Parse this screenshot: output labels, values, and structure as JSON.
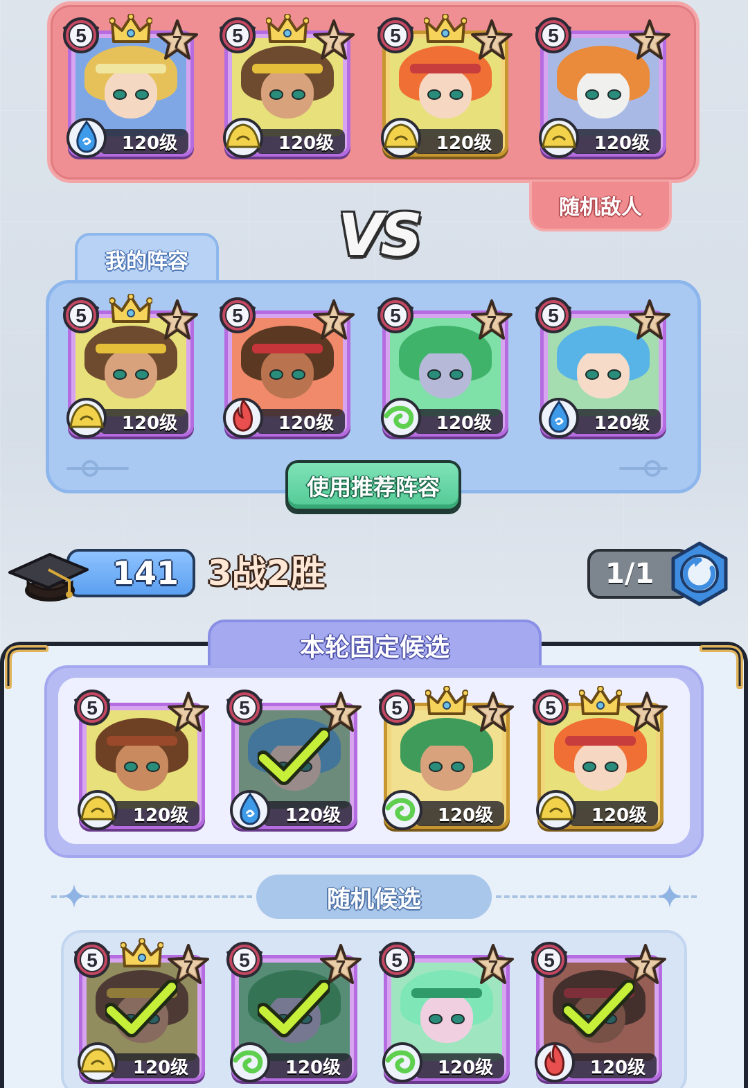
{
  "enemy": {
    "tag_label": "随机敌人",
    "heroes": [
      {
        "level": "120级",
        "stars": "5",
        "rank": "7",
        "element": "water",
        "crowned": true,
        "gold": false,
        "checked": false,
        "skin": "#f5d8c2",
        "hair": "#e6c15a",
        "bg": "#7fa7e6",
        "band": "#f0e6a0"
      },
      {
        "level": "120级",
        "stars": "5",
        "rank": "7",
        "element": "earth",
        "crowned": true,
        "gold": false,
        "checked": false,
        "skin": "#d7a27c",
        "hair": "#6e4a2e",
        "bg": "#e8e07a",
        "band": "#e6bf3a"
      },
      {
        "level": "120级",
        "stars": "5",
        "rank": "7",
        "element": "earth",
        "crowned": true,
        "gold": true,
        "checked": false,
        "skin": "#f6d7c2",
        "hair": "#ef6f35",
        "bg": "#e8e07a",
        "band": "#c73c3c"
      },
      {
        "level": "120级",
        "stars": "5",
        "rank": "7",
        "element": "earth",
        "crowned": false,
        "gold": false,
        "checked": false,
        "skin": "#f0f0ee",
        "hair": "#e98b3a",
        "bg": "#a9b9e6",
        "band": "#e98b3a"
      }
    ]
  },
  "vs_label": "VS",
  "my_team": {
    "tab_label": "我的阵容",
    "recommend_button": "使用推荐阵容",
    "heroes": [
      {
        "level": "120级",
        "stars": "5",
        "rank": "7",
        "element": "earth",
        "crowned": true,
        "gold": false,
        "checked": false,
        "skin": "#d7a27c",
        "hair": "#6e4a2e",
        "bg": "#e8e07a",
        "band": "#e6bf3a"
      },
      {
        "level": "120级",
        "stars": "5",
        "rank": "7",
        "element": "fire",
        "crowned": false,
        "gold": false,
        "checked": false,
        "skin": "#b9744f",
        "hair": "#5a3822",
        "bg": "#f08a6a",
        "band": "#c5353a"
      },
      {
        "level": "120级",
        "stars": "5",
        "rank": "7",
        "element": "wind",
        "crowned": false,
        "gold": false,
        "checked": false,
        "skin": "#b6b9d8",
        "hair": "#3fb36a",
        "bg": "#7fe0a8",
        "band": "#3fb36a"
      },
      {
        "level": "120级",
        "stars": "5",
        "rank": "7",
        "element": "water",
        "crowned": false,
        "gold": false,
        "checked": false,
        "skin": "#f6dcc8",
        "hair": "#58b4e6",
        "bg": "#a6ddb0",
        "band": "#58b4e6"
      }
    ]
  },
  "progress": {
    "score": "141",
    "record": "3战2胜",
    "refresh_count": "1/1"
  },
  "fixed_candidates": {
    "tab_label": "本轮固定候选",
    "heroes": [
      {
        "level": "120级",
        "stars": "5",
        "rank": "7",
        "element": "earth",
        "crowned": false,
        "gold": false,
        "checked": false,
        "skin": "#c88a5e",
        "hair": "#6e4124",
        "bg": "#e8e07a",
        "band": "#9a4a2a"
      },
      {
        "level": "120级",
        "stars": "5",
        "rank": "7",
        "element": "water",
        "crowned": false,
        "gold": false,
        "checked": true,
        "skin": "#f6dcc8",
        "hair": "#58b4e6",
        "bg": "#a6ddb0",
        "band": "#58b4e6"
      },
      {
        "level": "120级",
        "stars": "5",
        "rank": "7",
        "element": "wind",
        "crowned": true,
        "gold": true,
        "checked": false,
        "skin": "#d7a27c",
        "hair": "#3f9b5a",
        "bg": "#f0e090",
        "band": "#3f9b5a"
      },
      {
        "level": "120级",
        "stars": "5",
        "rank": "7",
        "element": "earth",
        "crowned": true,
        "gold": true,
        "checked": false,
        "skin": "#f6d7c2",
        "hair": "#ef6f35",
        "bg": "#e8e07a",
        "band": "#c73c3c"
      }
    ]
  },
  "random_candidates": {
    "label": "随机候选",
    "heroes": [
      {
        "level": "120级",
        "stars": "5",
        "rank": "7",
        "element": "earth",
        "crowned": true,
        "gold": false,
        "checked": true,
        "skin": "#d7a27c",
        "hair": "#6e4a2e",
        "bg": "#e8e07a",
        "band": "#e6bf3a"
      },
      {
        "level": "120级",
        "stars": "5",
        "rank": "7",
        "element": "wind",
        "crowned": false,
        "gold": false,
        "checked": true,
        "skin": "#b6b9d8",
        "hair": "#3fb36a",
        "bg": "#7fe0a8",
        "band": "#3fb36a"
      },
      {
        "level": "120级",
        "stars": "5",
        "rank": "7",
        "element": "wind",
        "crowned": false,
        "gold": false,
        "checked": false,
        "skin": "#f0cfe0",
        "hair": "#7fe6b8",
        "bg": "#9fe6c0",
        "band": "#2f9a6a"
      },
      {
        "level": "120级",
        "stars": "5",
        "rank": "7",
        "element": "fire",
        "crowned": false,
        "gold": false,
        "checked": true,
        "skin": "#b9744f",
        "hair": "#5a3822",
        "bg": "#f08a6a",
        "band": "#c5353a"
      }
    ]
  },
  "colors": {
    "enemy_panel": "#ef8f93",
    "my_panel": "#a9c9f3",
    "recommend_button": "#52c995",
    "fixed_panel": "#b7bbf3",
    "random_panel": "#d6e4f6",
    "water": "#3d9be9",
    "earth": "#f2d24a",
    "fire": "#ea4f4f",
    "wind": "#5fcf4f"
  }
}
